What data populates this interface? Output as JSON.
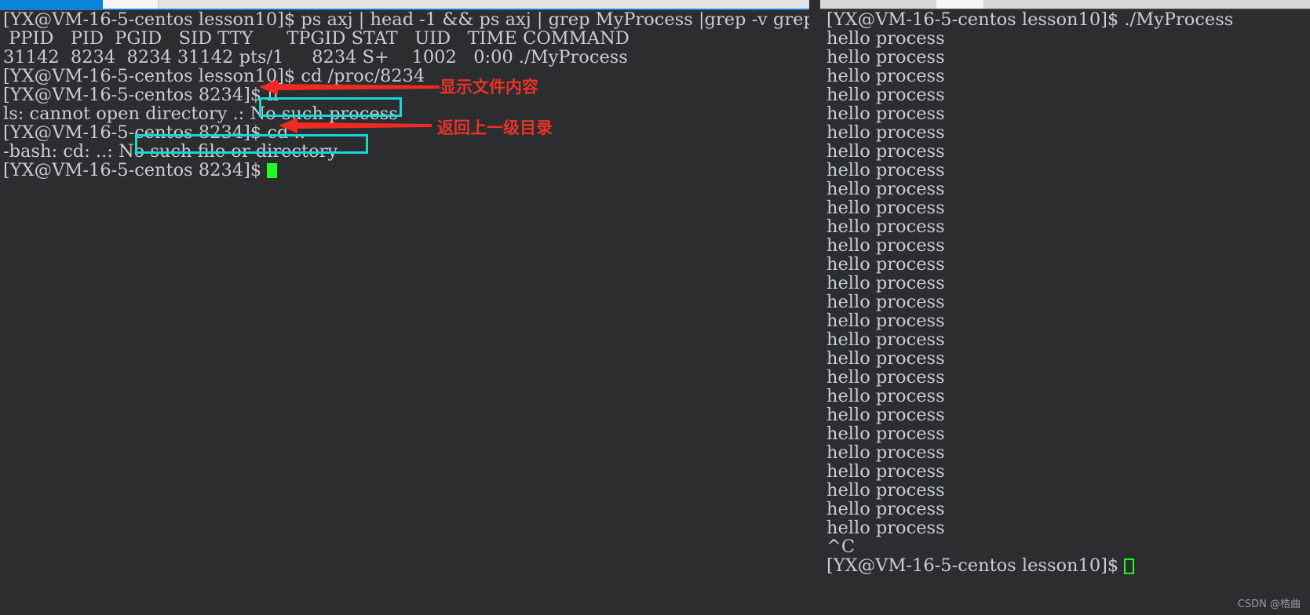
{
  "colors": {
    "terminal_bg": "#2b2d2e",
    "terminal_fg": "#c9ced6",
    "accent_blue": "#0a84d8",
    "cursor_green": "#1eff1e",
    "annotation_red": "#e8332a",
    "annotation_cyan": "#19d6d6",
    "scrollbar_thumb": "#8d8d8d",
    "watermark": "#9a9ea3"
  },
  "left_terminal": {
    "name": "left-terminal-pane",
    "lines": [
      "[YX@VM-16-5-centos lesson10]$ ps axj | head -1 && ps axj | grep MyProcess |grep -v grep",
      " PPID   PID  PGID   SID TTY      TPGID STAT   UID   TIME COMMAND",
      "31142  8234  8234 31142 pts/1     8234 S+    1002   0:00 ./MyProcess",
      "[YX@VM-16-5-centos lesson10]$ cd /proc/8234",
      "[YX@VM-16-5-centos 8234]$ ll",
      "ls: cannot open directory .: No such process",
      "[YX@VM-16-5-centos 8234]$ cd ..",
      "-bash: cd: ..: No such file or directory",
      "[YX@VM-16-5-centos 8234]$ "
    ],
    "prompt_last": "[YX@VM-16-5-centos 8234]$ "
  },
  "right_terminal": {
    "name": "right-terminal-pane",
    "command_line": "[YX@VM-16-5-centos lesson10]$ ./MyProcess",
    "output_line": "hello process",
    "output_repeat_count": 27,
    "interrupt": "^C",
    "prompt_last": "[YX@VM-16-5-centos lesson10]$ "
  },
  "annotations": [
    {
      "id": "note-show-file-content",
      "text": "显示文件内容",
      "arrow_target": "ll command"
    },
    {
      "id": "note-go-parent-dir",
      "text": "返回上一级目录",
      "arrow_target": "cd .. command"
    }
  ],
  "highlight_boxes": [
    {
      "id": "box-no-such-process",
      "text": "No such process"
    },
    {
      "id": "box-no-such-file",
      "text": "No such file or directory"
    }
  ],
  "watermark": {
    "text": "CSDN @梏曲"
  }
}
